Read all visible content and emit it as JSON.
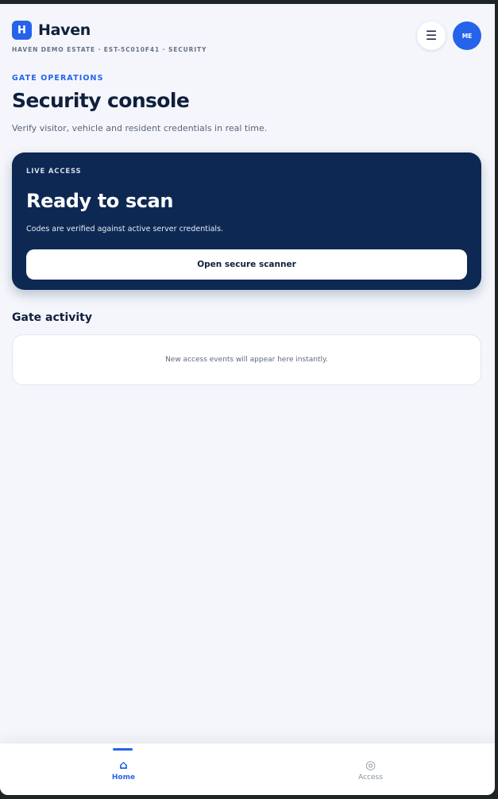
{
  "app": {
    "logo_letter": "H",
    "name": "Haven",
    "estate_line": "Haven Demo Estate · EST-5C010F41 · SECURITY"
  },
  "header": {
    "menu_icon": "☰",
    "avatar_initials": "ME"
  },
  "page": {
    "eyebrow": "GATE OPERATIONS",
    "title": "Security console",
    "subtitle": "Verify visitor, vehicle and resident credentials in real time."
  },
  "scan_card": {
    "eyebrow": "LIVE ACCESS",
    "title": "Ready to scan",
    "description": "Codes are verified against active server credentials.",
    "button_label": "Open secure scanner"
  },
  "activity": {
    "title": "Gate activity",
    "empty_message": "New access events will appear here instantly."
  },
  "bottom_nav": {
    "items": [
      {
        "label": "Home",
        "icon": "⌂",
        "icon_name": "home-icon",
        "active": true
      },
      {
        "label": "Access",
        "icon": "◎",
        "icon_name": "access-icon",
        "active": false
      }
    ]
  },
  "colors": {
    "accent": "#2563eb",
    "card_dark": "#0d2852",
    "background": "#f4f6fb",
    "text_primary": "#0f1f3d"
  }
}
